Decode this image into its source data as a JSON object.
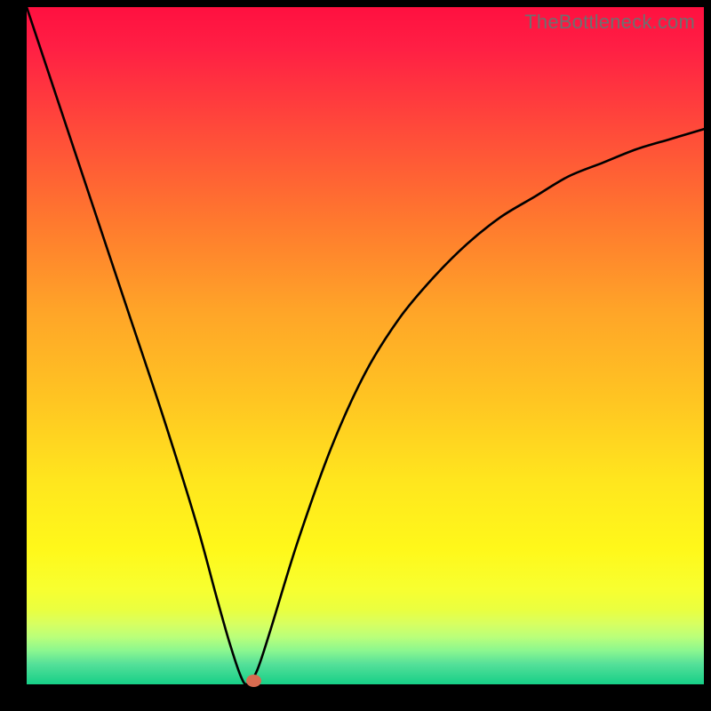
{
  "watermark": "TheBottleneck.com",
  "chart_data": {
    "type": "line",
    "title": "",
    "xlabel": "",
    "ylabel": "",
    "xlim": [
      0,
      100
    ],
    "ylim": [
      0,
      100
    ],
    "series": [
      {
        "name": "curve",
        "x": [
          0,
          5,
          10,
          15,
          20,
          25,
          28,
          30,
          31.5,
          32.5,
          34,
          36,
          40,
          45,
          50,
          55,
          60,
          65,
          70,
          75,
          80,
          85,
          90,
          95,
          100
        ],
        "values": [
          100,
          85,
          70,
          55,
          40,
          24,
          13,
          6,
          1.5,
          0,
          2,
          8,
          21,
          35,
          46,
          54,
          60,
          65,
          69,
          72,
          75,
          77,
          79,
          80.5,
          82
        ]
      }
    ],
    "marker": {
      "x": 33.5,
      "y": 0,
      "color": "#d86b50"
    },
    "background_gradient": {
      "type": "vertical",
      "stops": [
        {
          "pos": 0.0,
          "color": "#ff1040"
        },
        {
          "pos": 0.45,
          "color": "#ffa528"
        },
        {
          "pos": 0.8,
          "color": "#fff81a"
        },
        {
          "pos": 1.0,
          "color": "#16cf87"
        }
      ]
    }
  },
  "frame": {
    "border_px": 30,
    "border_color": "#000000"
  }
}
